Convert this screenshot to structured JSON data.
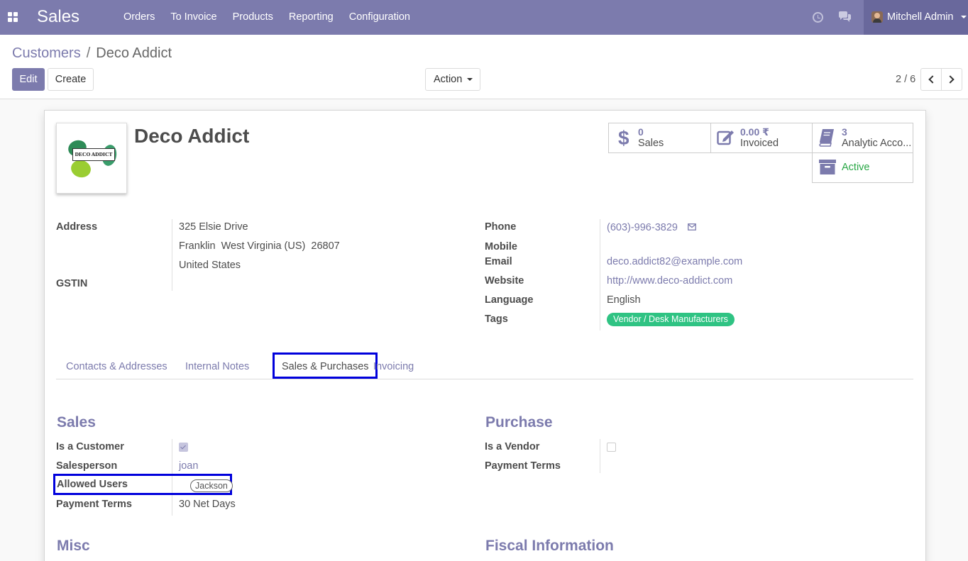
{
  "navbar": {
    "app_name": "Sales",
    "menu": [
      "Orders",
      "To Invoice",
      "Products",
      "Reporting",
      "Configuration"
    ],
    "user_name": "Mitchell Admin"
  },
  "breadcrumb": {
    "parent": "Customers",
    "separator": "/",
    "current": "Deco Addict"
  },
  "toolbar": {
    "edit_label": "Edit",
    "create_label": "Create",
    "action_label": "Action"
  },
  "pager": {
    "text": "2 / 6"
  },
  "partner": {
    "name": "Deco Addict",
    "logo_text": "DECO ADDICT"
  },
  "stats": {
    "sales_value": "0",
    "sales_label": "Sales",
    "invoiced_value": "0.00 ₹",
    "invoiced_label": "Invoiced",
    "analytic_value": "3",
    "analytic_label": "Analytic Acco...",
    "active_label": "Active"
  },
  "fields_left": {
    "address_label": "Address",
    "address_line1": "325 Elsie Drive",
    "address_line2": "Franklin  West Virginia (US)  26807",
    "address_line3": "United States",
    "gstin_label": "GSTIN"
  },
  "fields_right": {
    "phone_label": "Phone",
    "phone_value": "(603)-996-3829",
    "mobile_label": "Mobile",
    "email_label": "Email",
    "email_value": "deco.addict82@example.com",
    "website_label": "Website",
    "website_value": "http://www.deco-addict.com",
    "language_label": "Language",
    "language_value": "English",
    "tags_label": "Tags",
    "tag_value": "Vendor / Desk Manufacturers"
  },
  "tabs": [
    "Contacts & Addresses",
    "Internal Notes",
    "Sales & Purchases",
    "Invoicing"
  ],
  "sales_section": {
    "title": "Sales",
    "is_customer_label": "Is a Customer",
    "is_customer_checked": true,
    "salesperson_label": "Salesperson",
    "salesperson_value": "joan",
    "allowed_users_label": "Allowed Users",
    "allowed_users_value": "Jackson",
    "payment_terms_label": "Payment Terms",
    "payment_terms_value": "30 Net Days"
  },
  "purchase_section": {
    "title": "Purchase",
    "is_vendor_label": "Is a Vendor",
    "is_vendor_checked": false,
    "payment_terms_label": "Payment Terms"
  },
  "misc_title": "Misc",
  "fiscal_title": "Fiscal Information",
  "colors": {
    "brand": "#7c7bad",
    "tag": "#2fc383",
    "highlight": "#0000dc",
    "active": "#28a745"
  },
  "icons": [
    "apps-icon",
    "clock-icon",
    "chat-icon",
    "dollar-icon",
    "edit-invoice-icon",
    "book-icon",
    "archive-icon",
    "envelope-icon",
    "chevron-left-icon",
    "chevron-right-icon"
  ]
}
